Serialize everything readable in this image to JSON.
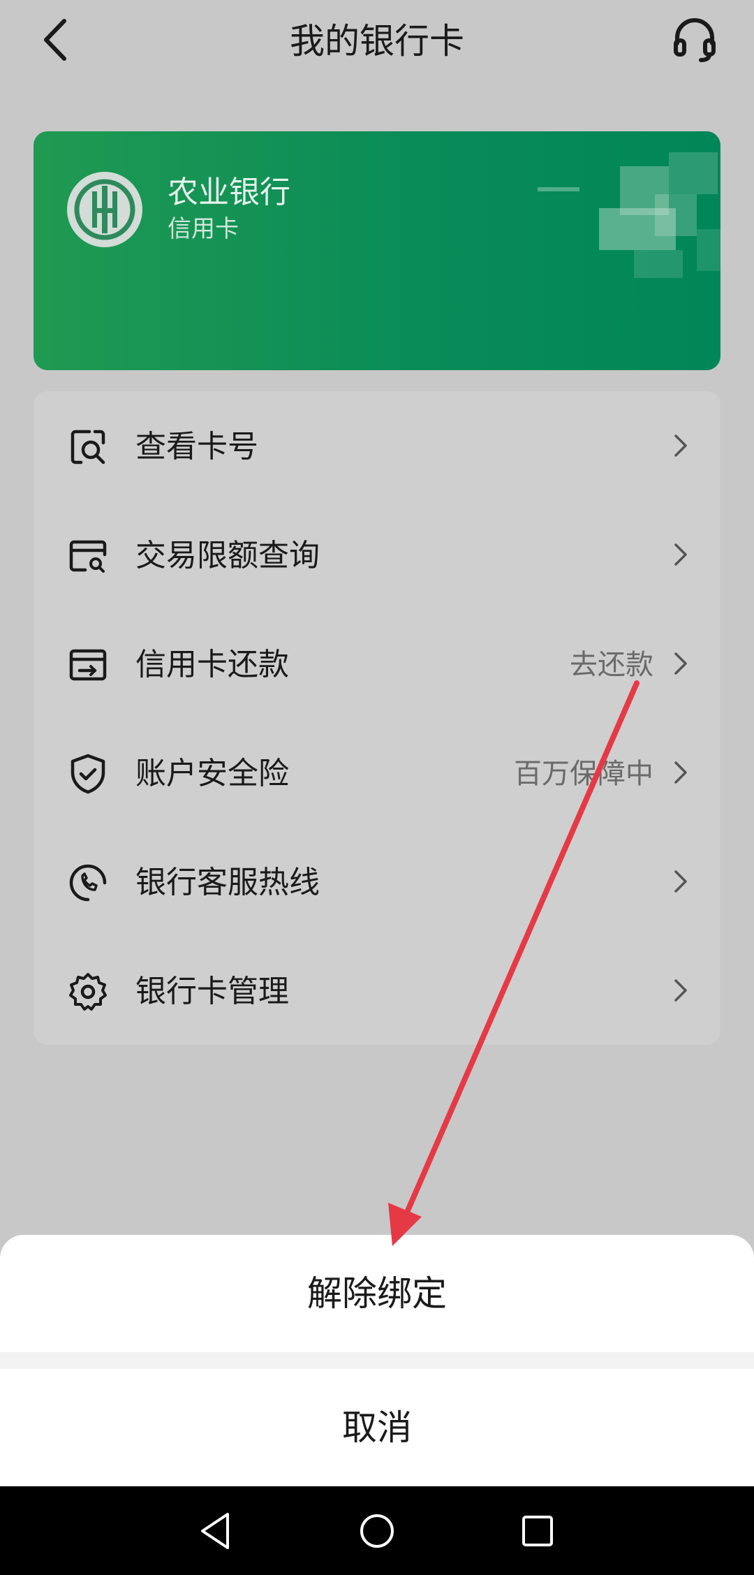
{
  "header": {
    "title": "我的银行卡",
    "back_icon": "back-arrow-icon",
    "service_icon": "headset-icon"
  },
  "card": {
    "bank_name": "农业银行",
    "card_type": "信用卡",
    "logo_icon": "abc-bank-logo",
    "colors": {
      "start": "#209a52",
      "end": "#008658"
    }
  },
  "menu": {
    "items": [
      {
        "label": "查看卡号",
        "value": "",
        "icon": "search-card-icon"
      },
      {
        "label": "交易限额查询",
        "value": "",
        "icon": "limit-query-icon"
      },
      {
        "label": "信用卡还款",
        "value": "去还款",
        "icon": "repayment-card-icon"
      },
      {
        "label": "账户安全险",
        "value": "百万保障中",
        "icon": "shield-check-icon"
      },
      {
        "label": "银行客服热线",
        "value": "",
        "icon": "phone-icon"
      },
      {
        "label": "银行卡管理",
        "value": "",
        "icon": "gear-icon"
      }
    ]
  },
  "sheet": {
    "unbind_label": "解除绑定",
    "cancel_label": "取消"
  },
  "annotation": {
    "color": "#e63946"
  },
  "system_nav": {
    "back": "nav-back-icon",
    "home": "nav-home-icon",
    "recents": "nav-recents-icon"
  }
}
